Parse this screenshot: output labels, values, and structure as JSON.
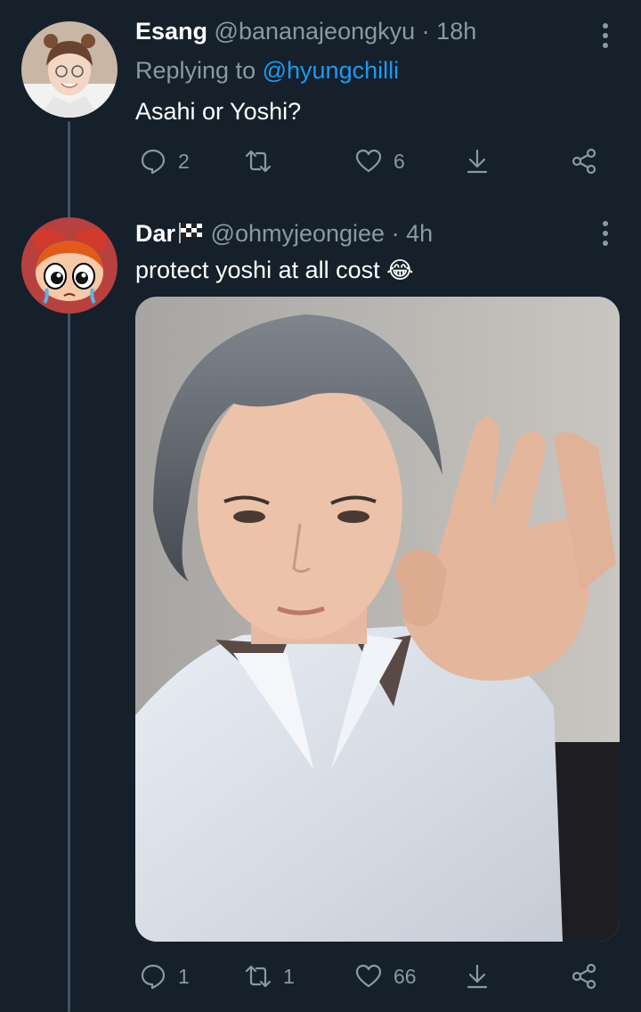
{
  "tweets": [
    {
      "display_name": "Esang",
      "handle": "@bananajeongkyu",
      "separator": "·",
      "time": "18h",
      "reply_prefix": "Replying to",
      "reply_to": "@hyungchilli",
      "text": "Asahi or Yoshi?",
      "counts": {
        "reply": "2",
        "retweet": "",
        "like": "6"
      }
    },
    {
      "display_name": "Dar",
      "name_emoji": "checkered-flag",
      "handle": "@ohmyjeongiee",
      "separator": "·",
      "time": "4h",
      "text": "protect yoshi at all cost",
      "text_emoji": "😂",
      "counts": {
        "reply": "1",
        "retweet": "1",
        "like": "66"
      }
    }
  ],
  "icons": [
    "reply-icon",
    "retweet-icon",
    "like-icon",
    "share-icon",
    "more-icon"
  ],
  "colors": {
    "background": "#15202b",
    "muted": "#8b98a5",
    "link": "#1d9bf0",
    "thread_line": "#3d5466"
  }
}
